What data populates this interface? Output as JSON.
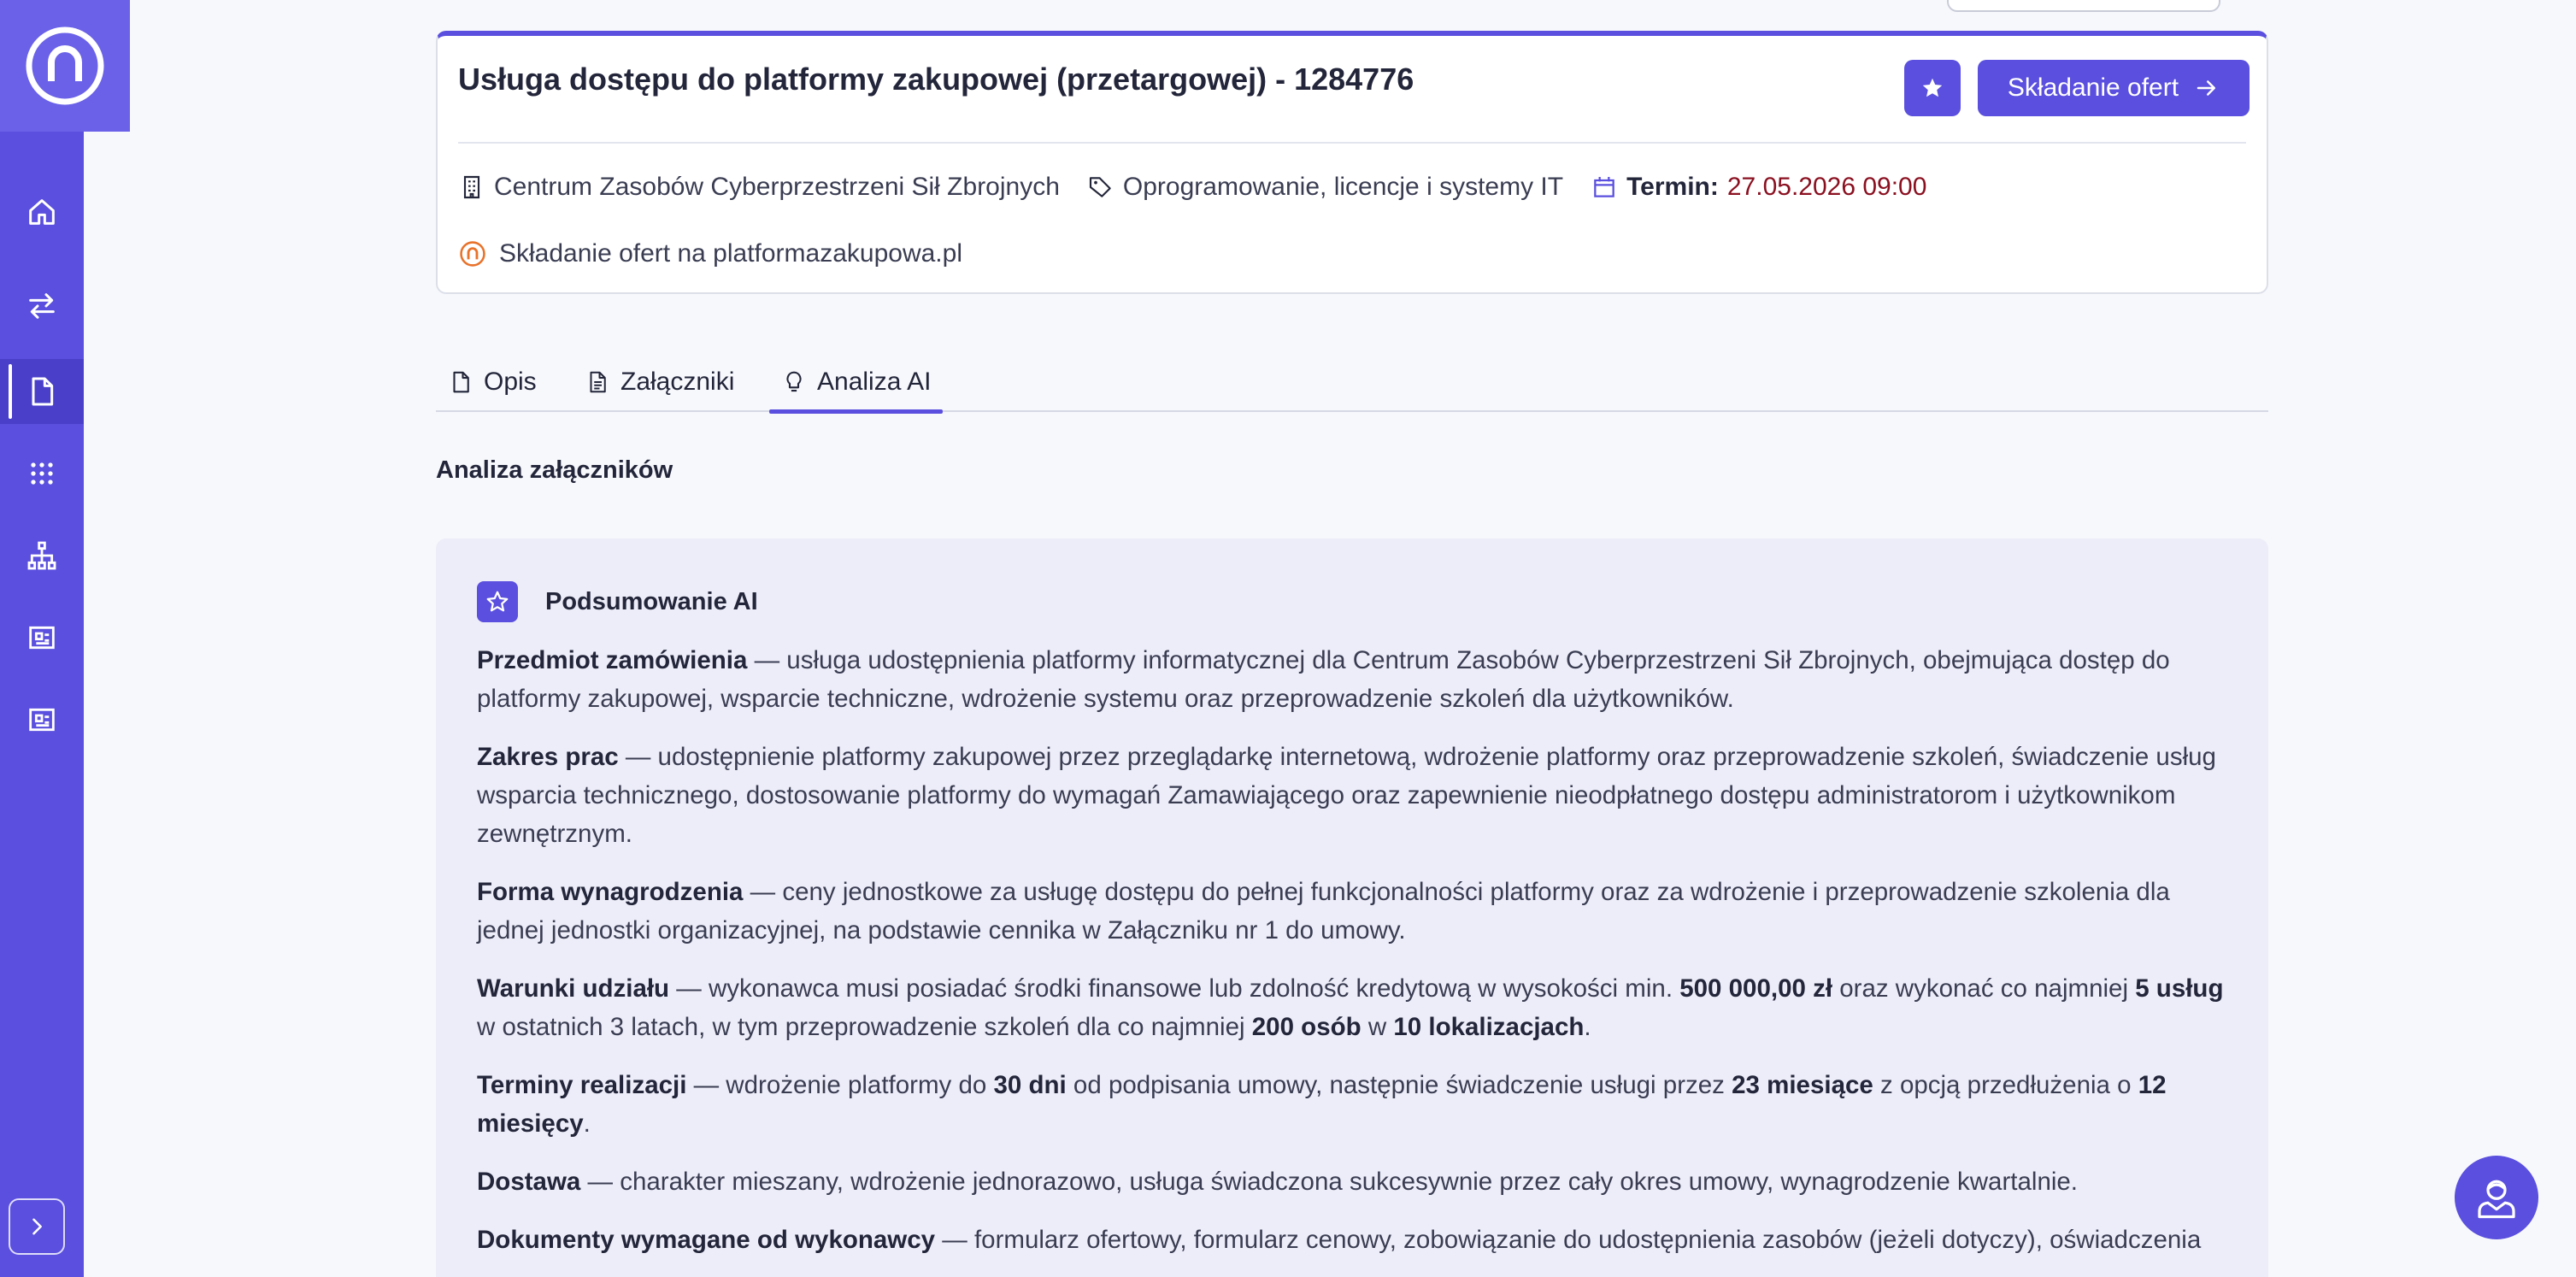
{
  "nav": {
    "items": [
      "home-icon",
      "transfer-icon",
      "document-icon",
      "grid-icon",
      "sitemap-icon",
      "board-icon",
      "board-icon"
    ]
  },
  "header": {
    "title": "Usługa dostępu do platformy zakupowej (przetargowej) - 1284776",
    "offer_button": "Składanie ofert",
    "organization": "Centrum Zasobów Cyberprzestrzeni Sił Zbrojnych",
    "category": "Oprogramowanie, licencje i systemy IT",
    "deadline_label": "Termin:",
    "deadline_value": "27.05.2026 09:00",
    "platform": "Składanie ofert na platformazakupowa.pl"
  },
  "tabs": [
    {
      "label": "Opis"
    },
    {
      "label": "Załączniki"
    },
    {
      "label": "Analiza AI"
    }
  ],
  "section_title": "Analiza załączników",
  "summary": {
    "title": "Podsumowanie AI",
    "p1_b": "Przedmiot zamówienia",
    "p1": " — usługa udostępnienia platformy informatycznej dla Centrum Zasobów Cyberprzestrzeni Sił Zbrojnych, obejmująca dostęp do platformy zakupowej, wsparcie techniczne, wdrożenie systemu oraz przeprowadzenie szkoleń dla użytkowników.",
    "p2_b": "Zakres prac",
    "p2": " — udostępnienie platformy zakupowej przez przeglądarkę internetową, wdrożenie platformy oraz przeprowadzenie szkoleń, świadczenie usług wsparcia technicznego, dostosowanie platformy do wymagań Zamawiającego oraz zapewnienie nieodpłatnego dostępu administratorom i użytkownikom zewnętrznym.",
    "p3_b": "Forma wynagrodzenia",
    "p3": " — ceny jednostkowe za usługę dostępu do pełnej funkcjonalności platformy oraz za wdrożenie i przeprowadzenie szkolenia dla jednej jednostki organizacyjnej, na podstawie cennika w Załączniku nr 1 do umowy.",
    "p4_b": "Warunki udziału",
    "p4_a": " — wykonawca musi posiadać środki finansowe lub zdolność kredytową w wysokości min. ",
    "p4_v1": "500 000,00 zł",
    "p4_c": " oraz wykonać co najmniej ",
    "p4_v2": "5 usług",
    "p4_d": " w ostatnich 3 latach, w tym przeprowadzenie szkoleń dla co najmniej ",
    "p4_v3": "200 osób",
    "p4_e": " w ",
    "p4_v4": "10 lokalizacjach",
    "p4_f": ".",
    "p5_b": "Terminy realizacji",
    "p5_a": " — wdrożenie platformy do ",
    "p5_v1": "30 dni",
    "p5_c": " od podpisania umowy, następnie świadczenie usługi przez ",
    "p5_v2": "23 miesiące",
    "p5_d": " z opcją przedłużenia o ",
    "p5_v3": "12 miesięcy",
    "p5_e": ".",
    "p6_b": "Dostawa",
    "p6": " — charakter mieszany, wdrożenie jednorazowo, usługa świadczona sukcesywnie przez cały okres umowy, wynagrodzenie kwartalnie.",
    "p7_b": "Dokumenty wymagane od wykonawcy",
    "p7": " — formularz ofertowy, formularz cenowy, zobowiązanie do udostępnienia zasobów (jeżeli dotyczy), oświadczenia"
  },
  "colors": {
    "accent": "#5a4fde",
    "deadline": "#8a1020",
    "platform_icon": "#e8722a"
  }
}
